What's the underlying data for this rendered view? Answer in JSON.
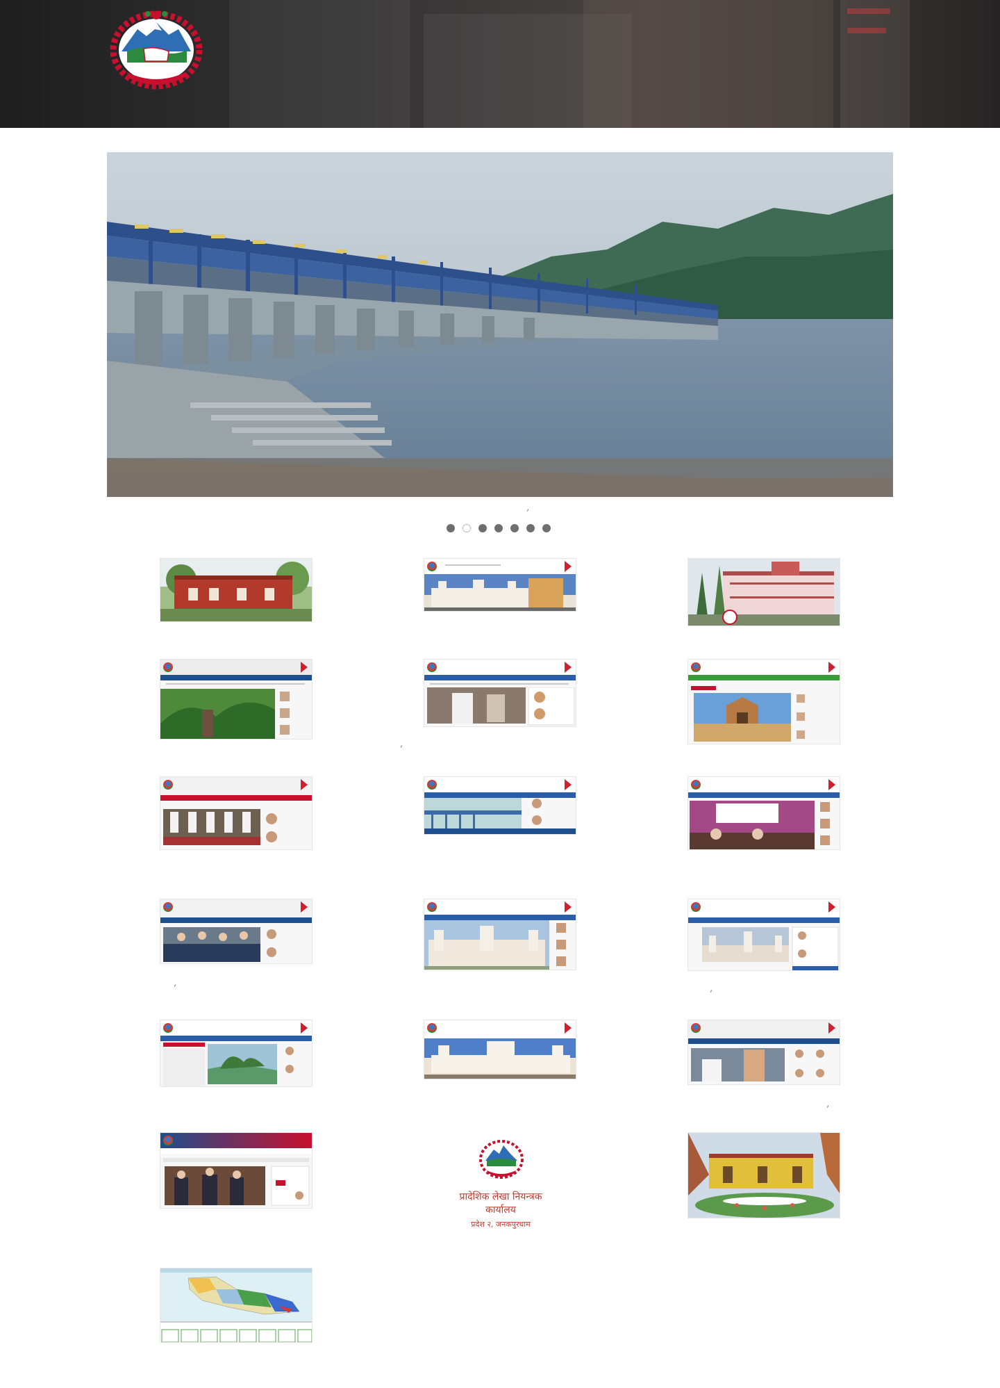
{
  "header": {
    "emblem_icon": "nepal-government-emblem-icon"
  },
  "hero": {
    "image": "barrage-river-photo"
  },
  "carousel": {
    "slide_count": 7,
    "active_index": 1
  },
  "grid": {
    "items": [
      {
        "icon": "office-building-photo"
      },
      {
        "icon": "website-screenshot-janakpur"
      },
      {
        "icon": "office-building-photo"
      },
      {
        "icon": "website-screenshot"
      },
      {
        "icon": "website-screenshot"
      },
      {
        "icon": "website-screenshot"
      },
      {
        "icon": "website-screenshot"
      },
      {
        "icon": "website-screenshot"
      },
      {
        "icon": "website-screenshot"
      },
      {
        "icon": "website-screenshot"
      },
      {
        "icon": "website-screenshot"
      },
      {
        "icon": "website-screenshot"
      },
      {
        "icon": "website-screenshot"
      },
      {
        "icon": "website-screenshot"
      },
      {
        "icon": "website-screenshot"
      },
      {
        "icon": "website-screenshot"
      },
      {
        "icon": "nepal-government-emblem-icon"
      },
      {
        "icon": "office-building-photo"
      },
      {
        "icon": "map-screenshot"
      }
    ]
  },
  "logo_tile": {
    "title": "प्रादेशिक लेखा नियन्त्रक कार्यालय",
    "subtitle": "प्रदेश २, जनकपुरधाम"
  },
  "colors": {
    "header_bg": "#2f2c2b",
    "emblem_red": "#c8102e",
    "emblem_blue": "#2f6db5",
    "dot": "#6f6f6f",
    "caption": "#6a8a94"
  }
}
